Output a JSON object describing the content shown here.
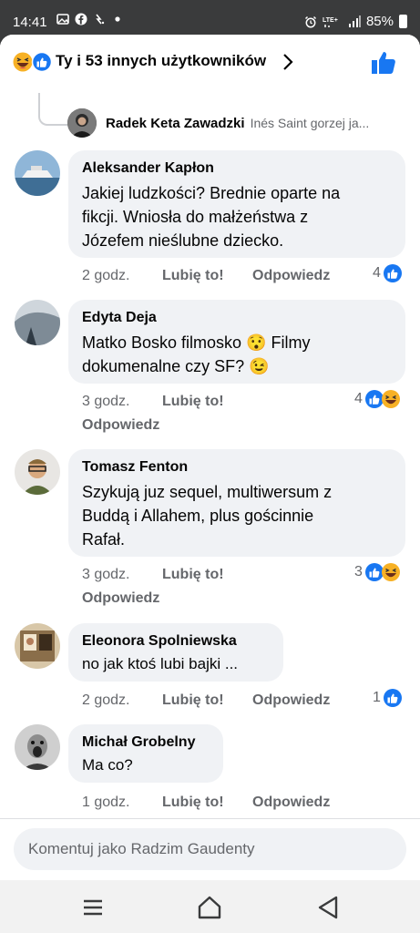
{
  "status": {
    "time": "14:41",
    "battery": "85%",
    "network": "LTE+"
  },
  "reactions_header": {
    "summary": "Ty i 53 innych użytkowników"
  },
  "previous_reply": {
    "author": "Radek Keta Zawadzki",
    "preview": "Inés Saint gorzej ja..."
  },
  "comments": [
    {
      "author": "Aleksander Kapłon",
      "lines": [
        "Jakiej ludzkości? Brednie oparte na",
        "fikcji. Wniosła do małżeństwa z",
        "Józefem nieślubne dziecko."
      ],
      "time": "2 godz.",
      "like": "Lubię to!",
      "reply": "Odpowiedz",
      "reactions": "4"
    },
    {
      "author": "Edyta Deja",
      "lines": [
        "Matko Bosko filmosko 😯 Filmy",
        "dokumenalne czy SF? 😉"
      ],
      "time": "3 godz.",
      "like": "Lubię to!",
      "reply": "Odpowiedz",
      "reactions": "4"
    },
    {
      "author": "Tomasz Fenton",
      "lines": [
        "Szykują juz sequel, multiwersum z",
        "Buddą i Allahem, plus gościnnie",
        "Rafał."
      ],
      "time": "3 godz.",
      "like": "Lubię to!",
      "reply": "Odpowiedz",
      "reactions": "3"
    },
    {
      "author": "Eleonora Spolniewska",
      "lines": [
        "no jak ktoś lubi bajki ..."
      ],
      "time": "2 godz.",
      "like": "Lubię to!",
      "reply": "Odpowiedz",
      "reactions": "1"
    },
    {
      "author": "Michał Grobelny",
      "lines": [
        "Ma co?"
      ],
      "time": "1 godz.",
      "like": "Lubię to!",
      "reply": "Odpowiedz"
    }
  ],
  "input": {
    "placeholder": "Komentuj jako Radzim Gaudenty"
  },
  "colors": {
    "accent": "#1877f2",
    "bubble": "#f0f2f5",
    "meta": "#65676b",
    "haha": "#f7b125"
  },
  "icons": [
    "haha-emoji-icon",
    "like-icon",
    "chevron-right-icon",
    "thumbs-up-icon",
    "menu-icon",
    "home-icon",
    "back-icon"
  ]
}
